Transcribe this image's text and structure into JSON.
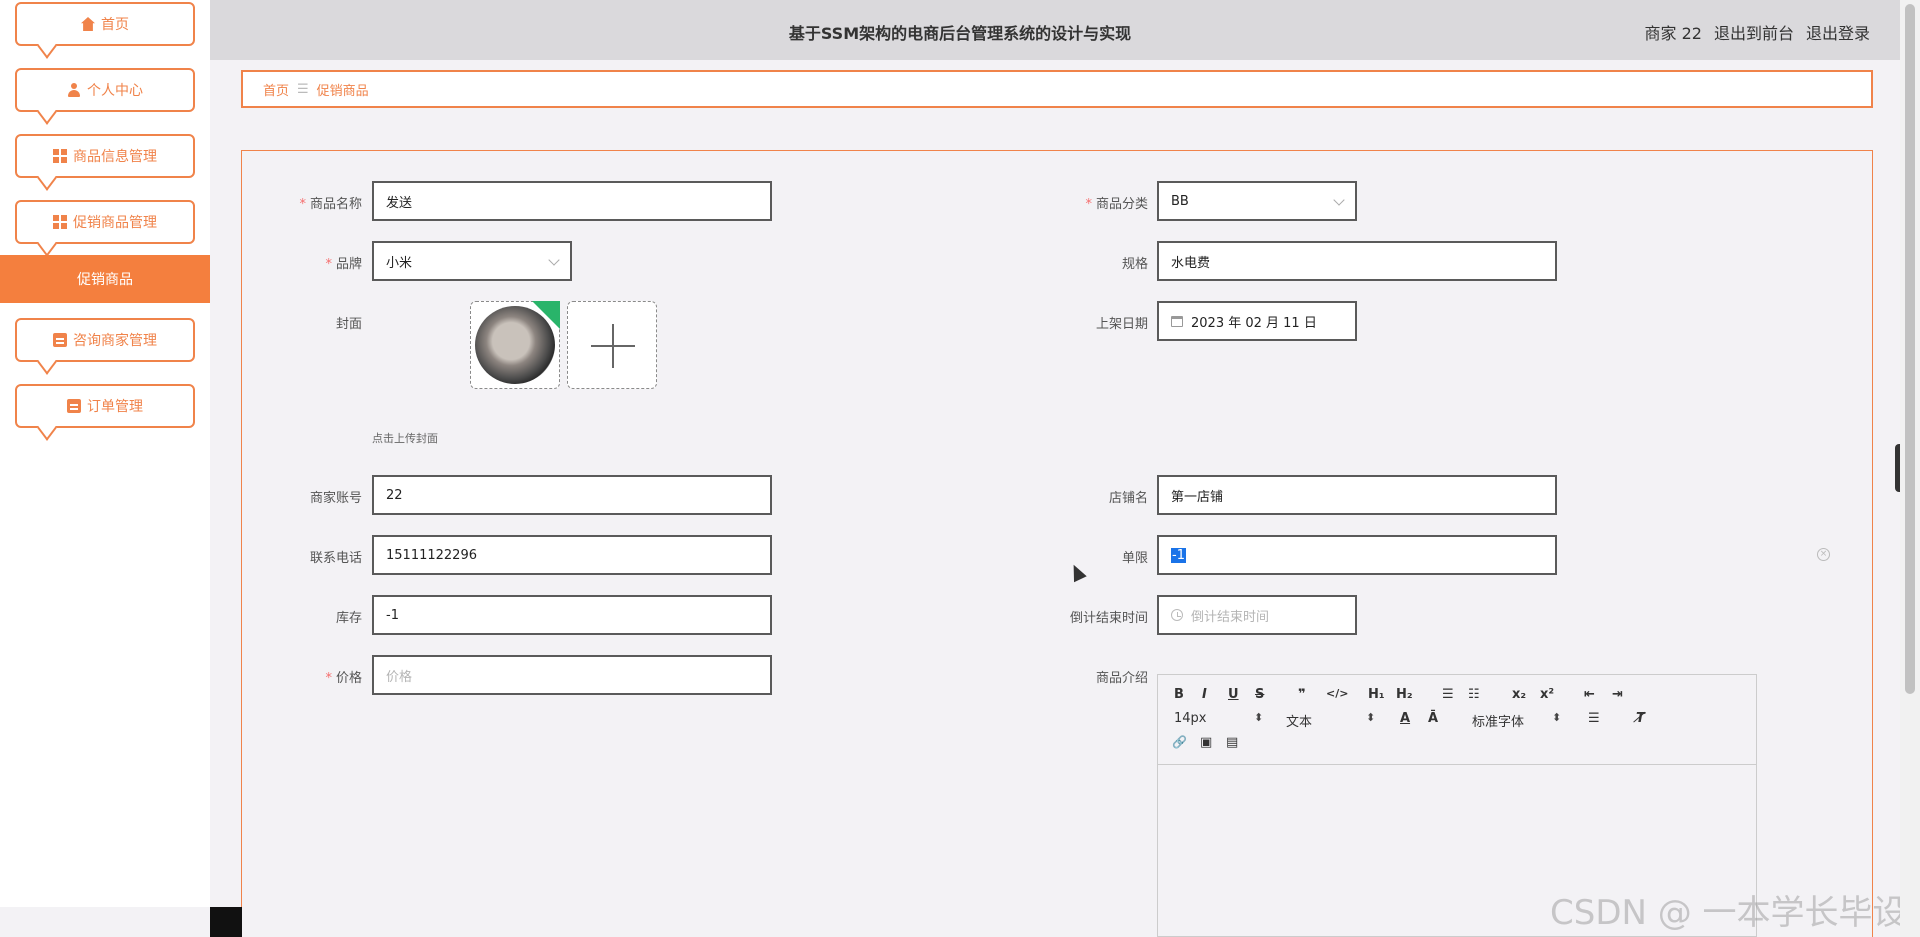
{
  "sidebar": {
    "items": [
      {
        "label": "首页",
        "icon": "home-icon"
      },
      {
        "label": "个人中心",
        "icon": "user-icon"
      },
      {
        "label": "商品信息管理",
        "icon": "grid-icon"
      },
      {
        "label": "促销商品管理",
        "icon": "grid-icon"
      },
      {
        "label": "咨询商家管理",
        "icon": "clipboard-icon"
      },
      {
        "label": "订单管理",
        "icon": "clipboard-icon"
      }
    ],
    "active_sub": "促销商品"
  },
  "header": {
    "title": "基于SSM架构的电商后台管理系统的设计与实现",
    "user": "商家 22",
    "to_front": "退出到前台",
    "logout": "退出登录"
  },
  "breadcrumb": {
    "home": "首页",
    "sep": "☰",
    "current": "促销商品"
  },
  "form": {
    "name": {
      "label": "商品名称",
      "value": "发送"
    },
    "category": {
      "label": "商品分类",
      "value": "BB"
    },
    "brand": {
      "label": "品牌",
      "value": "小米"
    },
    "spec": {
      "label": "规格",
      "value": "水电费"
    },
    "cover": {
      "label": "封面",
      "hint": "点击上传封面"
    },
    "listed_date": {
      "label": "上架日期",
      "value": "2023 年 02 月 11 日"
    },
    "merchant_account": {
      "label": "商家账号",
      "value": "22"
    },
    "shop_name": {
      "label": "店铺名",
      "value": "第一店铺"
    },
    "phone": {
      "label": "联系电话",
      "value": "15111122296"
    },
    "limit": {
      "label": "单限",
      "value": "-1"
    },
    "stock": {
      "label": "库存",
      "value": "-1"
    },
    "countdown": {
      "label": "倒计结束时间",
      "placeholder": "倒计结束时间"
    },
    "price": {
      "label": "价格",
      "placeholder": "价格"
    },
    "intro": {
      "label": "商品介绍"
    }
  },
  "editor": {
    "bold": "B",
    "italic": "I",
    "underline": "U",
    "strike": "S",
    "quote": "❞",
    "code": "</>",
    "h1": "H₁",
    "h2": "H₂",
    "ol": "☰",
    "ul": "☷",
    "sub": "x₂",
    "sup": "x²",
    "outdent": "⇤",
    "indent": "⇥",
    "size": "14px",
    "format": "文本",
    "font": "标准字体",
    "color": "A",
    "bg": "Ā",
    "align": "☰",
    "clear": "T̸",
    "link": "🔗",
    "image": "▣",
    "video": "▤"
  },
  "watermark": "CSDN @ 一本学长毕设",
  "colors": {
    "accent": "#f0834a",
    "active_bg": "#f47f3e",
    "required": "#f56c6c"
  }
}
